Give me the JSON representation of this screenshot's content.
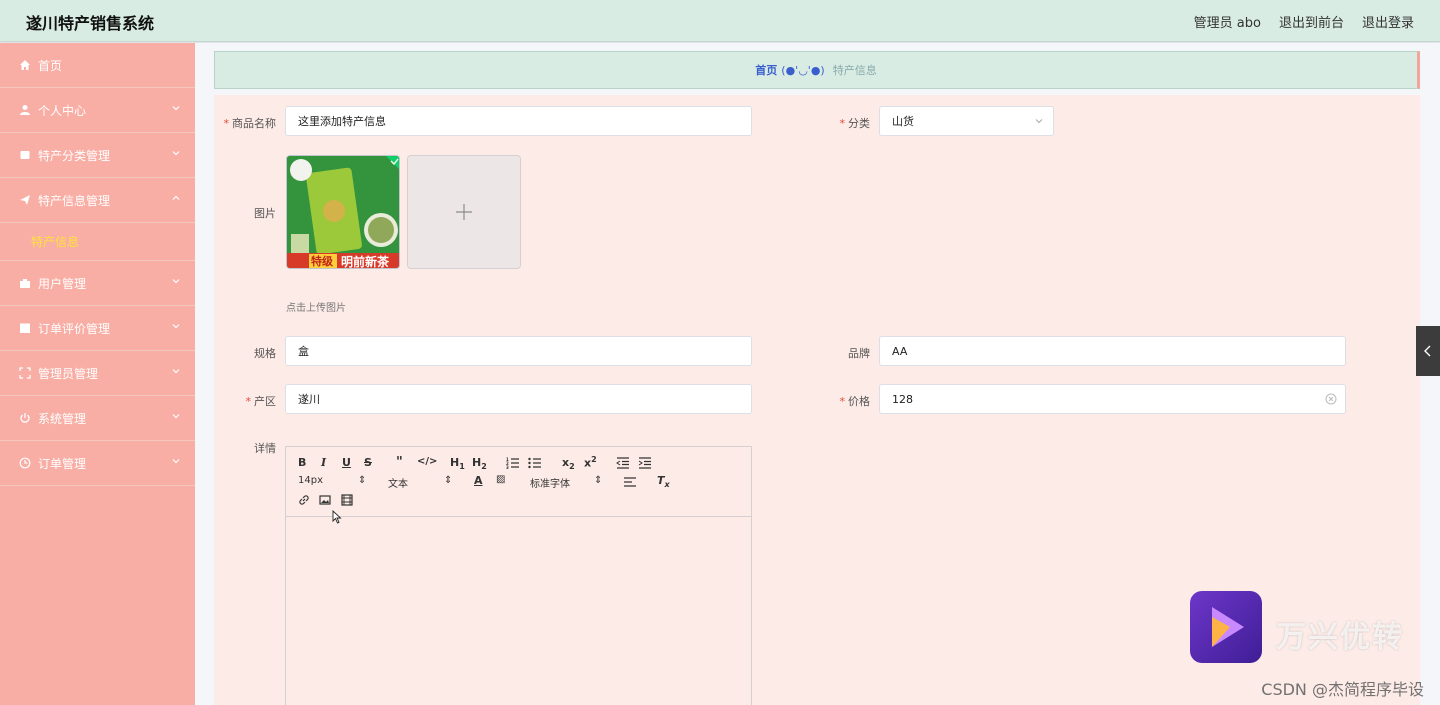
{
  "header": {
    "brand": "遂川特产销售系统",
    "admin_label": "管理员 abo",
    "back_to_front": "退出到前台",
    "logout": "退出登录"
  },
  "sidebar": {
    "items": [
      {
        "label": "首页",
        "icon": "home-icon"
      },
      {
        "label": "个人中心",
        "icon": "user-icon"
      },
      {
        "label": "特产分类管理",
        "icon": "book-icon"
      },
      {
        "label": "特产信息管理",
        "icon": "send-icon"
      },
      {
        "label": "用户管理",
        "icon": "briefcase-icon"
      },
      {
        "label": "订单评价管理",
        "icon": "box-icon"
      },
      {
        "label": "管理员管理",
        "icon": "frame-icon"
      },
      {
        "label": "系统管理",
        "icon": "power-icon"
      },
      {
        "label": "订单管理",
        "icon": "clock-icon"
      }
    ],
    "submenu_active": "特产信息",
    "active_color": "#ffe23d"
  },
  "breadcrumb": {
    "home": "首页",
    "emoticon": "(●'◡'●)",
    "current": "特产信息"
  },
  "form": {
    "name_label": "商品名称",
    "name_value": "这里添加特产信息",
    "category_label": "分类",
    "category_value": "山货",
    "image_label": "图片",
    "upload_hint": "点击上传图片",
    "image_badge_left": "特级",
    "image_badge_right": "明前新茶",
    "spec_label": "规格",
    "spec_value": "盒",
    "brand_label": "品牌",
    "brand_value": "AA",
    "origin_label": "产区",
    "origin_value": "遂川",
    "price_label": "价格",
    "price_value": "128",
    "detail_label": "详情"
  },
  "editor": {
    "font_size": "14px",
    "text_type": "文本",
    "font_family": "标准字体"
  },
  "watermark": {
    "brand_text": "万兴优转",
    "csdn_text": "CSDN @杰简程序毕设"
  }
}
